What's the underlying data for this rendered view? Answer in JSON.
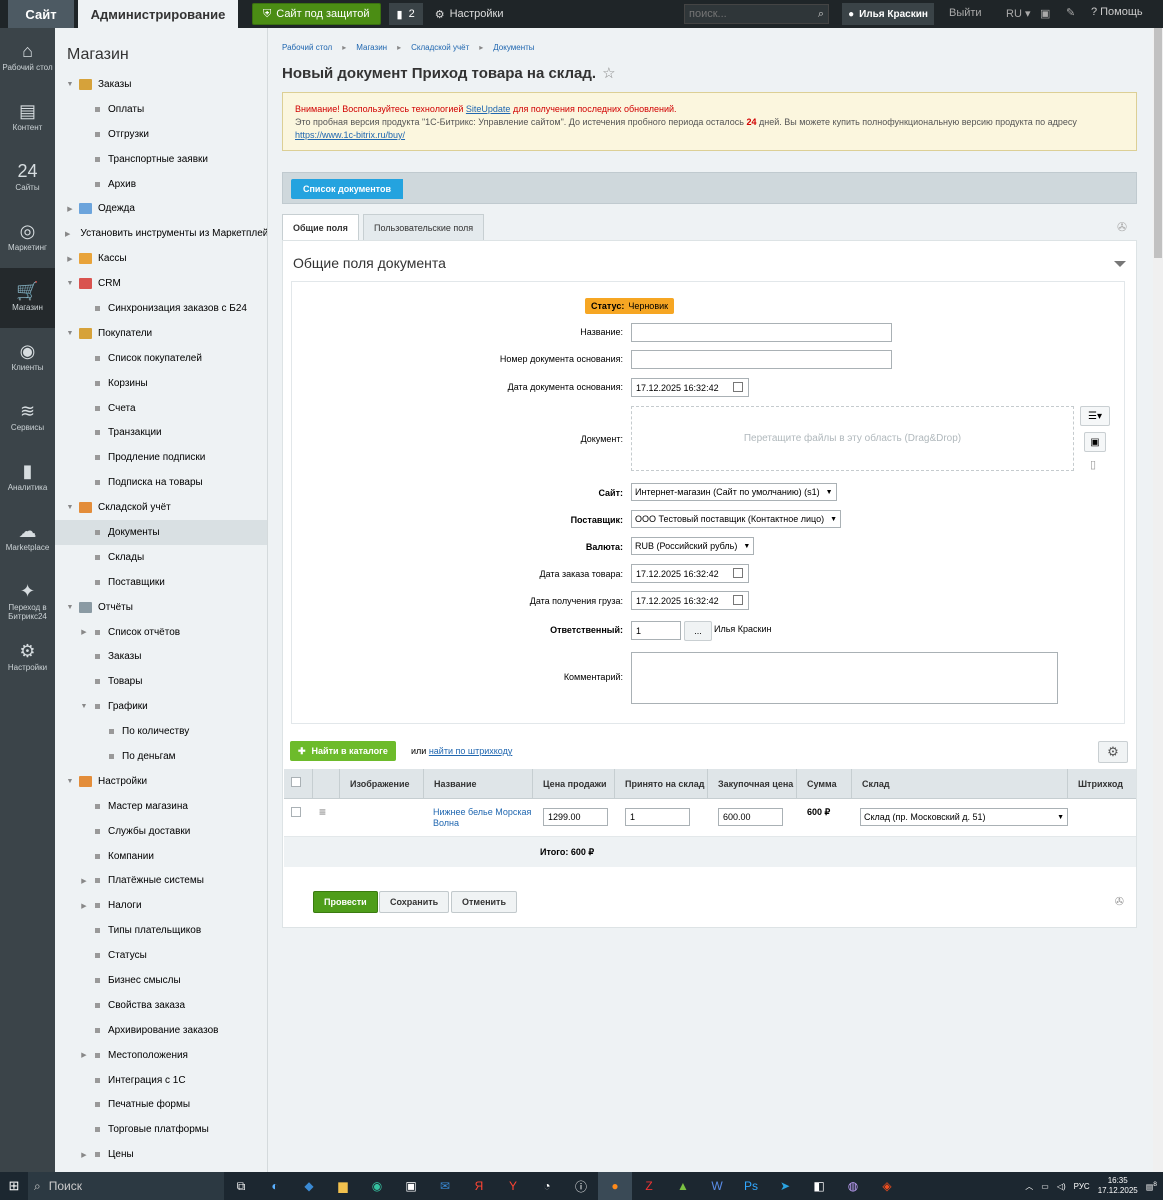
{
  "topbar": {
    "site_label": "Сайт",
    "admin_label": "Администрирование",
    "protected_label": "Сайт под защитой",
    "notif_count": "2",
    "settings_label": "Настройки",
    "search_placeholder": "поиск...",
    "user_name": "Илья Краскин",
    "exit_label": "Выйти",
    "lang_label": "RU",
    "help_label": "Помощь"
  },
  "leftnav": [
    {
      "icon": "home-icon",
      "glyph": "⌂",
      "label": "Рабочий стол"
    },
    {
      "icon": "content-icon",
      "glyph": "▤",
      "label": "Контент"
    },
    {
      "icon": "sites-icon",
      "glyph": "24",
      "label": "Сайты"
    },
    {
      "icon": "target-icon",
      "glyph": "◎",
      "label": "Маркетинг"
    },
    {
      "icon": "cart-icon",
      "glyph": "🛒",
      "label": "Магазин"
    },
    {
      "icon": "clients-icon",
      "glyph": "◉",
      "label": "Клиенты"
    },
    {
      "icon": "layers-icon",
      "glyph": "≋",
      "label": "Сервисы"
    },
    {
      "icon": "chart-icon",
      "glyph": "▮",
      "label": "Аналитика"
    },
    {
      "icon": "cloud-icon",
      "glyph": "☁",
      "label": "Marketplace"
    },
    {
      "icon": "b24-icon",
      "glyph": "✦",
      "label": "Переход в Битрикс24"
    },
    {
      "icon": "gear-icon",
      "glyph": "⚙",
      "label": "Настройки"
    }
  ],
  "sidemenu": {
    "title": "Магазин",
    "items": [
      {
        "label": "Заказы",
        "level": 0,
        "arrow": "▼",
        "folder": "#d6a23a"
      },
      {
        "label": "Оплаты",
        "level": 1
      },
      {
        "label": "Отгрузки",
        "level": 1
      },
      {
        "label": "Транспортные заявки",
        "level": 1
      },
      {
        "label": "Архив",
        "level": 1
      },
      {
        "label": "Одежда",
        "level": 0,
        "arrow": "▶",
        "folder": "#6ba4dc"
      },
      {
        "label": "Установить инструменты из Маркетплейс",
        "level": 0,
        "arrow": "▶",
        "folder": "#6ba4dc"
      },
      {
        "label": "Кассы",
        "level": 0,
        "arrow": "▶",
        "folder": "#e8a33a"
      },
      {
        "label": "CRM",
        "level": 0,
        "arrow": "▼",
        "folder": "#d9534f"
      },
      {
        "label": "Синхронизация заказов с Б24",
        "level": 1
      },
      {
        "label": "Покупатели",
        "level": 0,
        "arrow": "▼",
        "folder": "#d6a23a"
      },
      {
        "label": "Список покупателей",
        "level": 1
      },
      {
        "label": "Корзины",
        "level": 1
      },
      {
        "label": "Счета",
        "level": 1
      },
      {
        "label": "Транзакции",
        "level": 1
      },
      {
        "label": "Продление подписки",
        "level": 1
      },
      {
        "label": "Подписка на товары",
        "level": 1
      },
      {
        "label": "Складской учёт",
        "level": 0,
        "arrow": "▼",
        "folder": "#e38d3a"
      },
      {
        "label": "Документы",
        "level": 1,
        "active": true
      },
      {
        "label": "Склады",
        "level": 1
      },
      {
        "label": "Поставщики",
        "level": 1
      },
      {
        "label": "Отчёты",
        "level": 0,
        "arrow": "▼",
        "folder": "#8a9aa3"
      },
      {
        "label": "Список отчётов",
        "level": 1,
        "arrow": "▶"
      },
      {
        "label": "Заказы",
        "level": 1
      },
      {
        "label": "Товары",
        "level": 1
      },
      {
        "label": "Графики",
        "level": 1,
        "arrow": "▼"
      },
      {
        "label": "По количеству",
        "level": 2
      },
      {
        "label": "По деньгам",
        "level": 2
      },
      {
        "label": "Настройки",
        "level": 0,
        "arrow": "▼",
        "folder": "#e38d3a"
      },
      {
        "label": "Мастер магазина",
        "level": 1
      },
      {
        "label": "Службы доставки",
        "level": 1
      },
      {
        "label": "Компании",
        "level": 1
      },
      {
        "label": "Платёжные системы",
        "level": 1,
        "arrow": "▶"
      },
      {
        "label": "Налоги",
        "level": 1,
        "arrow": "▶"
      },
      {
        "label": "Типы плательщиков",
        "level": 1
      },
      {
        "label": "Статусы",
        "level": 1
      },
      {
        "label": "Бизнес смыслы",
        "level": 1
      },
      {
        "label": "Свойства заказа",
        "level": 1
      },
      {
        "label": "Архивирование заказов",
        "level": 1
      },
      {
        "label": "Местоположения",
        "level": 1,
        "arrow": "▶"
      },
      {
        "label": "Интеграция с 1С",
        "level": 1
      },
      {
        "label": "Печатные формы",
        "level": 1
      },
      {
        "label": "Торговые платформы",
        "level": 1
      },
      {
        "label": "Цены",
        "level": 1,
        "arrow": "▶"
      }
    ]
  },
  "breadcrumb": [
    "Рабочий стол",
    "Магазин",
    "Складской учёт",
    "Документы"
  ],
  "page_title": "Новый документ Приход товара на склад.",
  "warning": {
    "prefix": "Внимание! Воспользуйтесь технологией ",
    "link": "SiteUpdate",
    "suffix": " для получения последних обновлений.",
    "line2a": "Это пробная версия продукта \"1С-Битрикс: Управление сайтом\". До истечения пробного периода осталось ",
    "days": "24",
    "line2b": " дней. Вы можете купить полнофункциональную версию продукта по адресу ",
    "buy_link": "https://www.1c-bitrix.ru/buy/"
  },
  "doclist_button": "Список документов",
  "tabs": {
    "general": "Общие поля",
    "custom": "Пользовательские поля"
  },
  "panel_title": "Общие поля документа",
  "form": {
    "status_label": "Статус:",
    "status_value": "Черновик",
    "name_label": "Название:",
    "name_value": "",
    "base_num_label": "Номер документа основания:",
    "base_num_value": "",
    "base_date_label": "Дата документа основания:",
    "base_date_value": "17.12.2025 16:32:42",
    "doc_label": "Документ:",
    "dropzone_text": "Перетащите файлы в эту область (Drag&Drop)",
    "site_label": "Сайт:",
    "site_value": "Интернет-магазин (Сайт по умолчанию) (s1)",
    "supplier_label": "Поставщик:",
    "supplier_value": "ООО Тестовый поставщик (Контактное лицо)",
    "currency_label": "Валюта:",
    "currency_value": "RUB (Российский рубль)",
    "order_date_label": "Дата заказа товара:",
    "order_date_value": "17.12.2025 16:32:42",
    "receive_date_label": "Дата получения груза:",
    "receive_date_value": "17.12.2025 16:32:42",
    "responsible_label": "Ответственный:",
    "responsible_value": "1",
    "responsible_btn": "...",
    "responsible_name": "Илья Краскин",
    "comment_label": "Комментарий:",
    "comment_value": ""
  },
  "catalog": {
    "find_button": "Найти в каталоге",
    "or_text": "или",
    "barcode_link": "найти по штрихкоду"
  },
  "grid": {
    "headers": [
      "Изображение",
      "Название",
      "Цена продажи",
      "Принято на склад",
      "Закупочная цена",
      "Сумма",
      "Склад",
      "Штрихкод"
    ],
    "rows": [
      {
        "name": "Нижнее белье Морская Волна",
        "price": "1299.00",
        "qty": "1",
        "purchase": "600.00",
        "sum": "600 ₽",
        "store": "Склад (пр. Московский д. 51)"
      }
    ],
    "total": "Итого: 600 ₽"
  },
  "actions": {
    "conduct": "Провести",
    "save": "Сохранить",
    "cancel": "Отменить"
  },
  "taskbar": {
    "search_label": "Поиск",
    "lang": "РУС",
    "time": "16:35",
    "date": "17.12.2025",
    "notif": "8"
  }
}
